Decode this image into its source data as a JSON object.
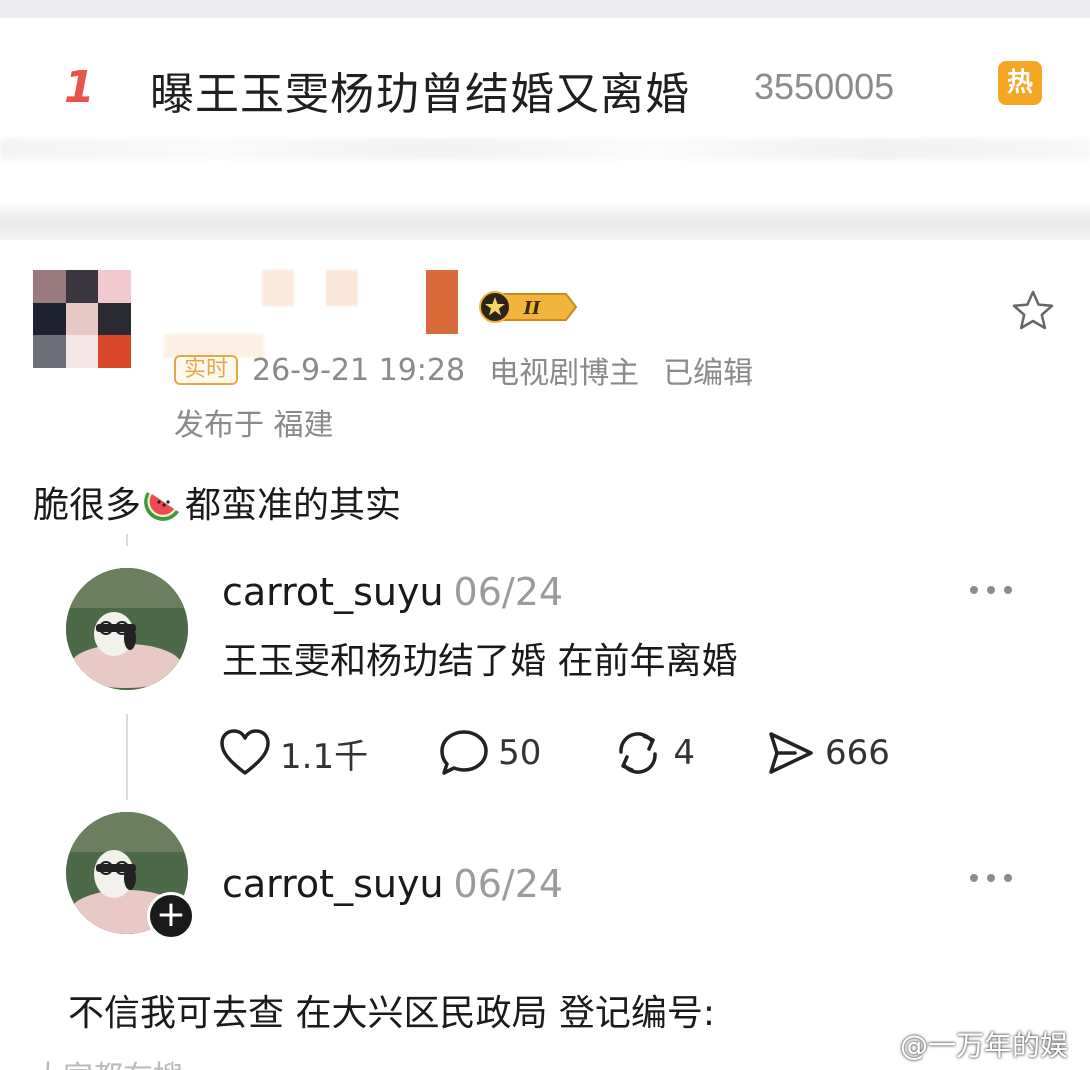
{
  "hot_search": {
    "rank": "1",
    "title": "曝王玉雯杨玏曾结婚又离婚",
    "count": "3550005",
    "badge": "热"
  },
  "post": {
    "live_tag": "实时",
    "datetime": "26-9-21 19:28",
    "author_role": "电视剧博主",
    "edited": "已编辑",
    "location": "发布于 福建",
    "text_before": "脆很多",
    "text_after": "都蛮准的其实",
    "emoji": "watermelon-icon"
  },
  "replies": [
    {
      "username": "carrot_suyu",
      "date": "06/24",
      "text": "王玉雯和杨玏结了婚 在前年离婚",
      "likes": "1.1千",
      "comments": "50",
      "reposts": "4",
      "shares": "666"
    },
    {
      "username": "carrot_suyu",
      "date": "06/24",
      "text": "不信我可去查 在大兴区民政局 登记编号:"
    }
  ],
  "cutoff_text": "大家都在搜",
  "watermark": "@一万年的娱",
  "colors": {
    "rank": "#e9534b",
    "hot_badge": "#f5a623",
    "live_tag": "#e8a64a",
    "meta_text": "#8a8a8a"
  }
}
